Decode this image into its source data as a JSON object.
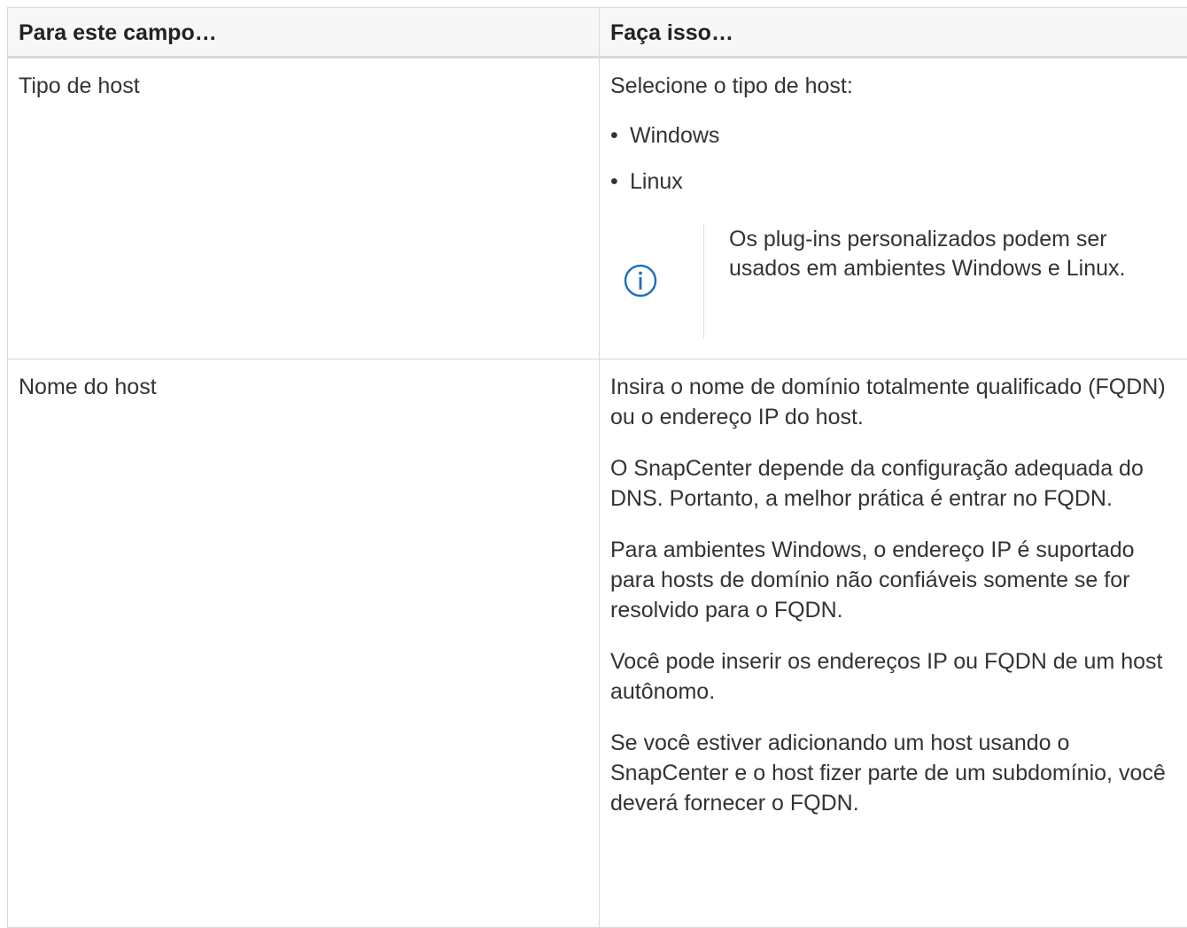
{
  "table": {
    "headers": [
      "Para este campo…",
      "Faça isso…"
    ],
    "rows": [
      {
        "field": "Tipo de host",
        "instruction": "Selecione o tipo de host:",
        "options": [
          "Windows",
          "Linux"
        ],
        "note": {
          "icon": "info-icon",
          "text": "Os plug-ins personalizados podem ser usados em ambientes Windows e Linux."
        }
      },
      {
        "field": "Nome do host",
        "paragraphs": [
          "Insira o nome de domínio totalmente qualificado (FQDN) ou o endereço IP do host.",
          "O SnapCenter depende da configuração adequada do DNS. Portanto, a melhor prática é entrar no FQDN.",
          "Para ambientes Windows, o endereço IP é suportado para hosts de domínio não confiáveis somente se for resolvido para o FQDN.",
          "Você pode inserir os endereços IP ou FQDN de um host autônomo.",
          "Se você estiver adicionando um host usando o SnapCenter e o host fizer parte de um subdomínio, você deverá fornecer o FQDN."
        ]
      }
    ]
  },
  "colors": {
    "icon": "#1a6ec2",
    "border": "#d9d9d9",
    "header_bg": "#f7f7f7"
  }
}
